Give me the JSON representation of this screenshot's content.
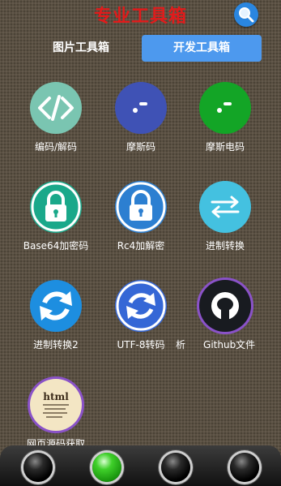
{
  "header": {
    "title": "专业工具箱",
    "search_icon": "search-icon"
  },
  "tabs": [
    {
      "label": "图片工具箱",
      "selected": false
    },
    {
      "label": "开发工具箱",
      "selected": true
    }
  ],
  "tools": [
    {
      "label": "编码/解码",
      "icon": "code-brackets-icon",
      "color": "#7ac5b1"
    },
    {
      "label": "摩斯码",
      "icon": "morse-icon",
      "color": "#3f52b5"
    },
    {
      "label": "摩斯电码",
      "icon": "morse-signal-icon",
      "color": "#13a526"
    },
    {
      "label": "Base64加密码",
      "icon": "lock-icon",
      "color": "#1aa88a"
    },
    {
      "label": "Rc4加解密",
      "icon": "lock-icon",
      "color": "#2c7fd1"
    },
    {
      "label": "进制转换",
      "icon": "swap-arrows-icon",
      "color": "#44c1e0"
    },
    {
      "label": "进制转换2",
      "icon": "refresh-icon",
      "color": "#1d8ee0"
    },
    {
      "label": "UTF-8转码",
      "icon": "refresh-icon",
      "color": "#3567d6"
    },
    {
      "label": "析",
      "icon": "",
      "color": ""
    },
    {
      "label": "Github文件",
      "icon": "github-icon",
      "color": "#181b20"
    },
    {
      "label": "网页源码获取",
      "icon": "html-document-icon",
      "color": "#f3e6c4"
    }
  ],
  "colors": {
    "title": "#e11b1b",
    "tab_selected": "#4d99ee",
    "background": "#5a5042"
  }
}
